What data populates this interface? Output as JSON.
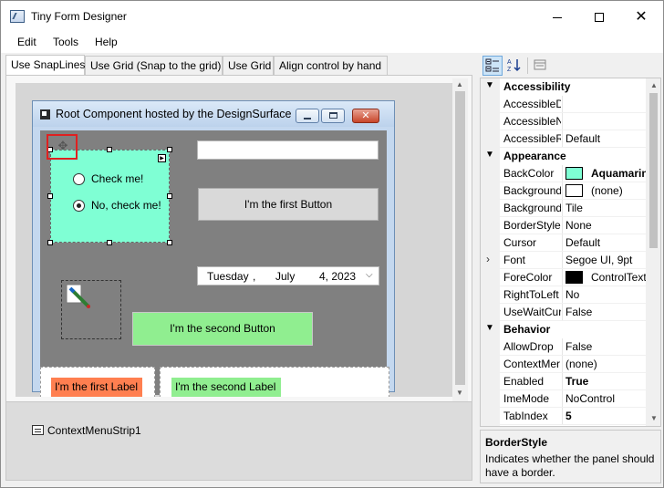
{
  "window": {
    "title": "Tiny Form Designer",
    "minimize_glyph": "",
    "maximize_glyph": "",
    "close_glyph": "✕"
  },
  "menu": [
    "Edit",
    "Tools",
    "Help"
  ],
  "tabs": [
    {
      "label": "Use SnapLines",
      "active": true
    },
    {
      "label": "Use Grid (Snap to the grid)",
      "active": false
    },
    {
      "label": "Use Grid",
      "active": false
    },
    {
      "label": "Align control by hand",
      "active": false
    }
  ],
  "hosted_form": {
    "title": "Root Component hosted by the DesignSurface ...",
    "close_glyph": "✕",
    "panel_color": "#7fffd4",
    "radio1": "Check me!",
    "radio2": "No, check me!",
    "radio2_checked": true,
    "textbox_value": "",
    "button1": "I'm the first Button",
    "date": {
      "day": "Tuesday",
      "sep": ",",
      "month": "July",
      "date": "4, 2023"
    },
    "button2": "I'm the second Button",
    "label1": "I'm the first Label",
    "label2": "I'm the second Label",
    "label1_color": "#ff7f50",
    "label2_color": "#90ee90"
  },
  "component_tray": {
    "item": "ContextMenuStrip1"
  },
  "properties": {
    "categories": [
      {
        "name": "Accessibility",
        "rows": [
          {
            "name": "AccessibleD",
            "value": ""
          },
          {
            "name": "AccessibleN",
            "value": ""
          },
          {
            "name": "AccessibleR",
            "value": "Default"
          }
        ]
      },
      {
        "name": "Appearance",
        "rows": [
          {
            "name": "BackColor",
            "value": "Aquamarine",
            "swatch": "#7fffd4",
            "bold": true
          },
          {
            "name": "Background",
            "value": "(none)",
            "swatch": "#ffffff"
          },
          {
            "name": "Background",
            "value": "Tile"
          },
          {
            "name": "BorderStyle",
            "value": "None"
          },
          {
            "name": "Cursor",
            "value": "Default"
          },
          {
            "name": "Font",
            "value": "Segoe UI, 9pt",
            "expandable": true
          },
          {
            "name": "ForeColor",
            "value": "ControlText",
            "swatch": "#000000"
          },
          {
            "name": "RightToLeft",
            "value": "No"
          },
          {
            "name": "UseWaitCur",
            "value": "False"
          }
        ]
      },
      {
        "name": "Behavior",
        "rows": [
          {
            "name": "AllowDrop",
            "value": "False"
          },
          {
            "name": "ContextMer",
            "value": "(none)"
          },
          {
            "name": "Enabled",
            "value": "True",
            "bold": true
          },
          {
            "name": "ImeMode",
            "value": "NoControl"
          },
          {
            "name": "TabIndex",
            "value": "5",
            "bold": true
          }
        ]
      }
    ],
    "help_title": "BorderStyle",
    "help_desc": "Indicates whether the panel should have a border."
  }
}
